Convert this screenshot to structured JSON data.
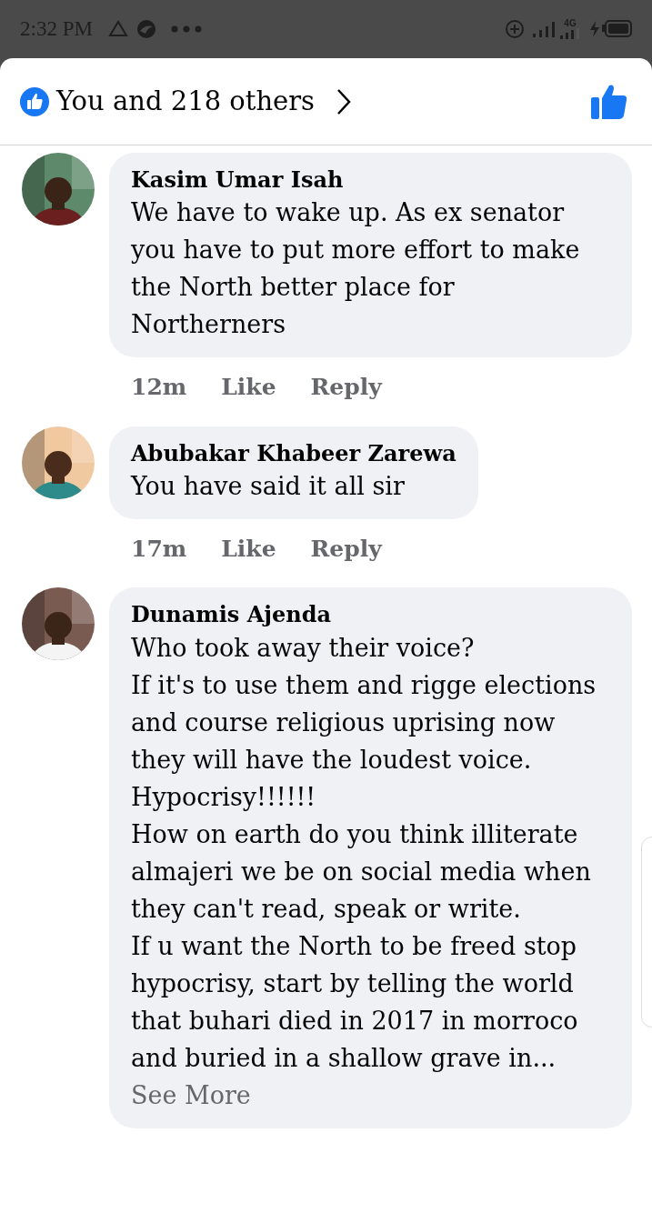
{
  "status_bar": {
    "time": "2:32 PM",
    "network_type": "4G"
  },
  "header": {
    "reactions_summary": "You and 218 others"
  },
  "comments": [
    {
      "author": "Kasim Umar Isah",
      "text": "We have to wake up. As ex senator you have to put more effort to make the North better place for Northerners",
      "time": "12m",
      "like": "Like",
      "reply": "Reply"
    },
    {
      "author": "Abubakar Khabeer Zarewa",
      "text": "You have said it all sir",
      "time": "17m",
      "like": "Like",
      "reply": "Reply"
    },
    {
      "author": "Dunamis Ajenda",
      "text": "Who took away their voice?\nIf it's to use them and rigge elections and course religious uprising now they will have the loudest voice.\nHypocrisy!!!!!!\nHow on earth do you think illiterate almajeri we be on social media when they can't read, speak or write.\nIf u want the North to be freed stop hypocrisy, start by telling the world that buhari died in 2017 in morroco and buried in a shallow grave in...",
      "see_more": "See More"
    }
  ]
}
